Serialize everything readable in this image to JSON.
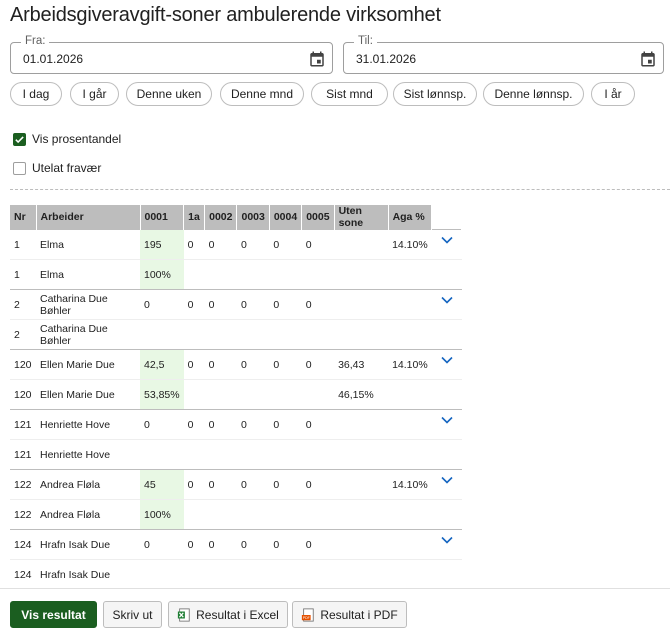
{
  "title": "Arbeidsgiveravgift-soner ambulerende virksomhet",
  "date_from": {
    "label": "Fra:",
    "value": "01.01.2026"
  },
  "date_to": {
    "label": "Til:",
    "value": "31.01.2026"
  },
  "quick_ranges": [
    "I dag",
    "I går",
    "Denne uken",
    "Denne mnd",
    "Sist mnd",
    "Sist lønnsp.",
    "Denne lønnsp.",
    "I år"
  ],
  "options": {
    "show_percent": {
      "label": "Vis prosentandel",
      "checked": true
    },
    "exclude_absence": {
      "label": "Utelat fravær",
      "checked": false
    }
  },
  "table": {
    "headers": [
      "Nr",
      "Arbeider",
      "0001",
      "1a",
      "0002",
      "0003",
      "0004",
      "0005",
      "Uten sone",
      "Aga %"
    ],
    "rows": [
      {
        "kind": "main",
        "cells": [
          "1",
          "Elma",
          "195",
          "0",
          "0",
          "0",
          "0",
          "0",
          "",
          "14.10%"
        ],
        "hl": true
      },
      {
        "kind": "pct",
        "cells": [
          "1",
          "Elma",
          "100%",
          "",
          "",
          "",
          "",
          "",
          "",
          ""
        ],
        "hl": true
      },
      {
        "kind": "main",
        "cells": [
          "2",
          "Catharina Due Bøhler",
          "0",
          "0",
          "0",
          "0",
          "0",
          "0",
          "",
          ""
        ],
        "hl": false
      },
      {
        "kind": "pct",
        "cells": [
          "2",
          "Catharina Due Bøhler",
          "",
          "",
          "",
          "",
          "",
          "",
          "",
          ""
        ],
        "hl": false
      },
      {
        "kind": "main",
        "cells": [
          "120",
          "Ellen Marie Due",
          "42,5",
          "0",
          "0",
          "0",
          "0",
          "0",
          "36,43",
          "14.10%"
        ],
        "hl": true
      },
      {
        "kind": "pct",
        "cells": [
          "120",
          "Ellen Marie Due",
          "53,85%",
          "",
          "",
          "",
          "",
          "",
          "46,15%",
          ""
        ],
        "hl": true
      },
      {
        "kind": "main",
        "cells": [
          "121",
          "Henriette Hove",
          "0",
          "0",
          "0",
          "0",
          "0",
          "0",
          "",
          ""
        ],
        "hl": false
      },
      {
        "kind": "pct",
        "cells": [
          "121",
          "Henriette Hove",
          "",
          "",
          "",
          "",
          "",
          "",
          "",
          ""
        ],
        "hl": false
      },
      {
        "kind": "main",
        "cells": [
          "122",
          "Andrea Fløla",
          "45",
          "0",
          "0",
          "0",
          "0",
          "0",
          "",
          "14.10%"
        ],
        "hl": true
      },
      {
        "kind": "pct",
        "cells": [
          "122",
          "Andrea Fløla",
          "100%",
          "",
          "",
          "",
          "",
          "",
          "",
          ""
        ],
        "hl": true
      },
      {
        "kind": "main",
        "cells": [
          "124",
          "Hrafn Isak Due",
          "0",
          "0",
          "0",
          "0",
          "0",
          "0",
          "",
          ""
        ],
        "hl": false
      },
      {
        "kind": "pct",
        "cells": [
          "124",
          "Hrafn Isak Due",
          "",
          "",
          "",
          "",
          "",
          "",
          "",
          ""
        ],
        "hl": false
      }
    ]
  },
  "actions": {
    "show": "Vis resultat",
    "print": "Skriv ut",
    "excel": "Resultat i Excel",
    "pdf": "Resultat i PDF"
  },
  "colors": {
    "primary": "#1b5e20",
    "highlight": "#e8f8e4",
    "header_bg": "#bdbdbd",
    "chevron": "#1565c0"
  }
}
